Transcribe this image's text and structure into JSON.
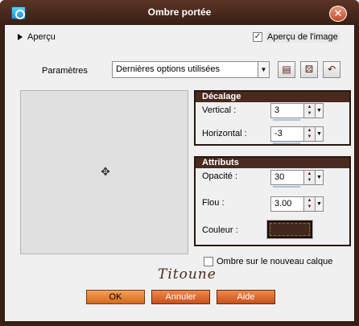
{
  "window": {
    "title": "Ombre portée"
  },
  "preview": {
    "toggle_label": "Aperçu",
    "image_preview_label": "Aperçu de l'image",
    "image_preview_checked": true
  },
  "settings": {
    "label": "Paramètres",
    "preset_value": "Dernières options utilisées"
  },
  "offset_group": {
    "title": "Décalage",
    "vertical_label": "Vertical :",
    "vertical_value": "3",
    "horizontal_label": "Horizontal :",
    "horizontal_value": "-3"
  },
  "attributes_group": {
    "title": "Attributs",
    "opacity_label": "Opacité :",
    "opacity_value": "30",
    "blur_label": "Flou :",
    "blur_value": "3.00",
    "color_label": "Couleur :",
    "color_hex": "#40291b"
  },
  "new_layer": {
    "label": "Ombre sur le nouveau calque",
    "checked": false
  },
  "signature": "Titoune",
  "buttons": {
    "ok": "OK",
    "cancel": "Annuler",
    "help": "Aide"
  }
}
